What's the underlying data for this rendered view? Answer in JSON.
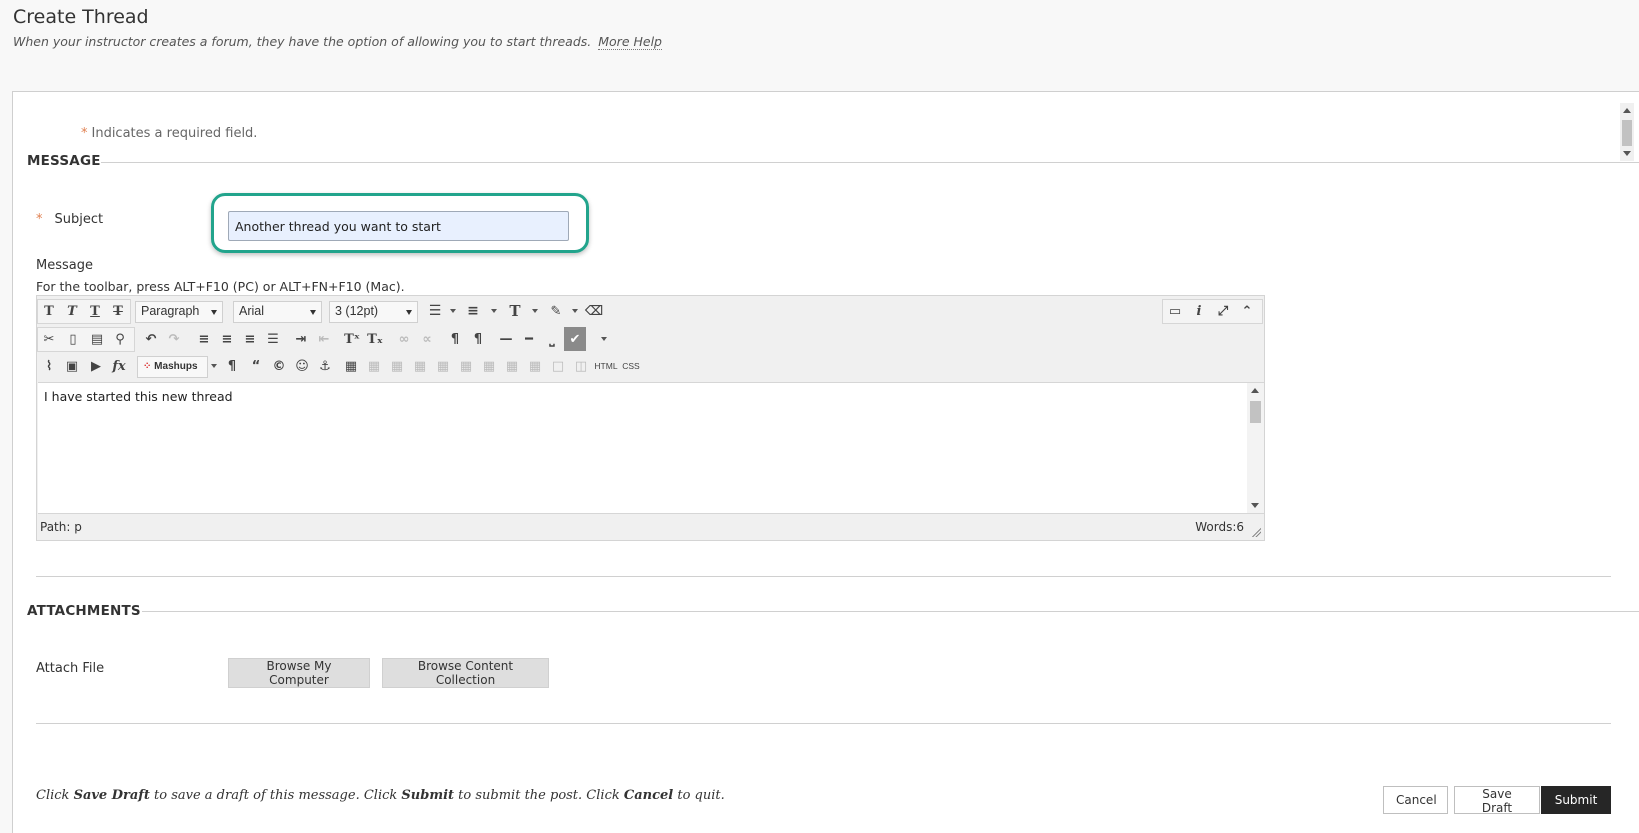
{
  "page": {
    "title": "Create Thread",
    "description": "When your instructor creates a forum, they have the option of allowing you to start threads.",
    "more_help": "More Help"
  },
  "required_note": {
    "star": "*",
    "text": "Indicates a required field."
  },
  "message_section": {
    "heading": "MESSAGE",
    "subject_label": "Subject",
    "subject_value": "Another thread you want to start",
    "message_label": "Message",
    "toolbar_hint": "For the toolbar, press ALT+F10 (PC) or ALT+FN+F10 (Mac)."
  },
  "editor": {
    "format_select": "Paragraph",
    "font_select": "Arial",
    "size_select": "3 (12pt)",
    "mashups_label": "Mashups",
    "html_label": "HTML",
    "css_label": "CSS",
    "body_text": "I have started this new thread",
    "path_text": "Path: p",
    "word_count": "Words:6"
  },
  "attachments_section": {
    "heading": "ATTACHMENTS",
    "attach_label": "Attach File",
    "browse_computer": "Browse My Computer",
    "browse_collection": "Browse Content Collection"
  },
  "footer": {
    "note_parts": [
      "Click ",
      "Save Draft",
      " to save a draft of this message. Click ",
      "Submit",
      " to submit the post. Click ",
      "Cancel",
      " to quit."
    ],
    "cancel": "Cancel",
    "save_draft": "Save Draft",
    "submit": "Submit"
  },
  "colors": {
    "accent_ring": "#22a48c",
    "required_star": "#e08050",
    "submit_bg": "#262626"
  }
}
